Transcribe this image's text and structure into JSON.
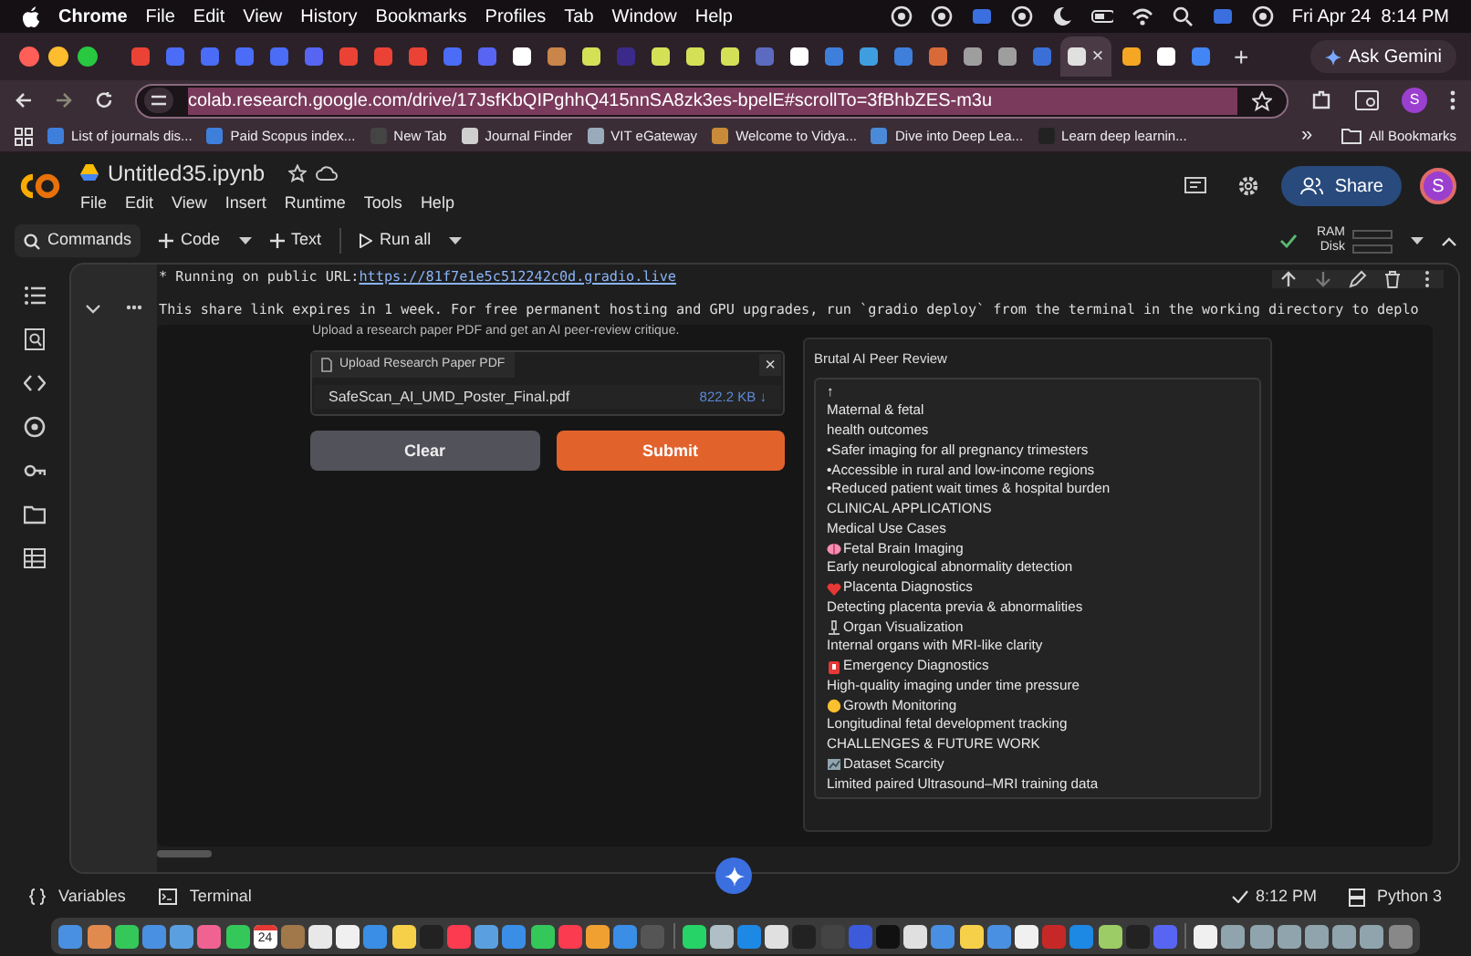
{
  "menubar": {
    "app": "Chrome",
    "items": [
      "File",
      "Edit",
      "View",
      "History",
      "Bookmarks",
      "Profiles",
      "Tab",
      "Window",
      "Help"
    ],
    "clock": "Fri Apr 24  8:14 PM"
  },
  "tabs": [
    {
      "selected": false
    },
    {
      "selected": false
    },
    {
      "selected": false
    },
    {
      "selected": false
    },
    {
      "selected": false
    },
    {
      "selected": false
    },
    {
      "selected": false
    },
    {
      "selected": false
    },
    {
      "selected": false
    },
    {
      "selected": false
    },
    {
      "selected": false
    },
    {
      "selected": false
    },
    {
      "selected": false
    },
    {
      "selected": false
    },
    {
      "selected": false
    },
    {
      "selected": false
    },
    {
      "selected": false
    },
    {
      "selected": false
    },
    {
      "selected": false
    },
    {
      "selected": false
    },
    {
      "selected": false
    },
    {
      "selected": false
    },
    {
      "selected": false
    },
    {
      "selected": false
    },
    {
      "selected": false
    },
    {
      "selected": false
    },
    {
      "selected": false
    },
    {
      "selected": true
    },
    {
      "selected": false
    },
    {
      "selected": false
    },
    {
      "selected": false
    }
  ],
  "tab_close": "×",
  "new_tab": "+",
  "ask_gemini": "Ask Gemini",
  "address": "colab.research.google.com/drive/17JsfKbQIPghhQ415nnSA8zk3es-bpelE#scrollTo=3fBhbZES-m3u",
  "profile": "S",
  "bookmarks": [
    "List of journals dis...",
    "Paid Scopus index...",
    "New Tab",
    "Journal Finder",
    "VIT eGateway",
    "Welcome to Vidya...",
    "Dive into Deep Lea...",
    "Learn deep learnin..."
  ],
  "bookmarks_more": "»",
  "all_bookmarks": "All Bookmarks",
  "notebook": {
    "title": "Untitled35.ipynb",
    "menus": [
      "File",
      "Edit",
      "View",
      "Insert",
      "Runtime",
      "Tools",
      "Help"
    ],
    "share": "Share",
    "avatar": "S"
  },
  "toolbar": {
    "commands": "Commands",
    "code": "Code",
    "text": "Text",
    "run_all": "Run all",
    "ram": "RAM",
    "disk": "Disk"
  },
  "output": {
    "url_label": "* Running on public URL: ",
    "url": "https://81f7e1e5c512242c0d.gradio.live",
    "notice": "This share link expires in 1 week. For free permanent hosting and GPU upgrades, run `gradio deploy` from the terminal in the working directory to deplo",
    "description": "Upload a research paper PDF and get an AI peer-review critique."
  },
  "upload": {
    "label": "Upload Research Paper PDF",
    "close": "×",
    "file": "SafeScan_AI_UMD_Poster_Final.pdf",
    "size": "822.2 KB ↓"
  },
  "buttons": {
    "clear": "Clear",
    "submit": "Submit"
  },
  "review": {
    "label": "Brutal AI Peer Review",
    "lines": [
      {
        "kind": "text",
        "text": "↑"
      },
      {
        "kind": "text",
        "text": "Maternal & fetal"
      },
      {
        "kind": "text",
        "text": "health outcomes"
      },
      {
        "kind": "text",
        "text": "•Safer imaging for all pregnancy trimesters"
      },
      {
        "kind": "text",
        "text": "•Accessible in rural and low-income regions"
      },
      {
        "kind": "text",
        "text": "•Reduced patient wait times & hospital burden"
      },
      {
        "kind": "text",
        "text": "CLINICAL APPLICATIONS"
      },
      {
        "kind": "text",
        "text": "Medical Use Cases"
      },
      {
        "kind": "feature",
        "text": "Fetal Brain Imaging"
      },
      {
        "kind": "text",
        "text": "Early neurological abnormality detection"
      },
      {
        "kind": "feature",
        "text": "Placenta Diagnostics"
      },
      {
        "kind": "text",
        "text": "Detecting placenta previa & abnormalities"
      },
      {
        "kind": "feature",
        "text": "Organ Visualization"
      },
      {
        "kind": "text",
        "text": "Internal organs with MRI-like clarity"
      },
      {
        "kind": "feature",
        "text": "Emergency Diagnostics"
      },
      {
        "kind": "text",
        "text": "High-quality imaging under time pressure"
      },
      {
        "kind": "feature",
        "text": "Growth Monitoring"
      },
      {
        "kind": "text",
        "text": "Longitudinal fetal development tracking"
      },
      {
        "kind": "text",
        "text": "CHALLENGES & FUTURE WORK"
      },
      {
        "kind": "feature",
        "text": "Dataset Scarcity"
      },
      {
        "kind": "text",
        "text": "Limited paired Ultrasound–MRI training data"
      }
    ]
  },
  "status": {
    "variables": "Variables",
    "terminal": "Terminal",
    "time": "8:12 PM",
    "runtime": "Python 3"
  },
  "dock": {
    "calendar_day": "24"
  }
}
